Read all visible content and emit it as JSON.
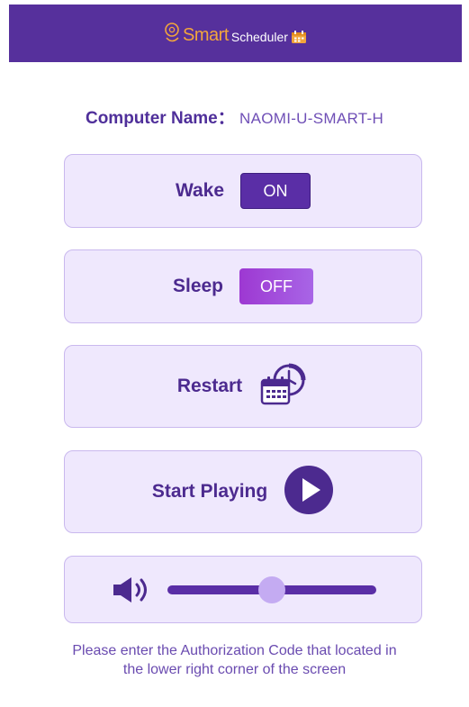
{
  "header": {
    "logo_smart": "Smart",
    "logo_scheduler": "Scheduler"
  },
  "computer": {
    "label": "Computer Name：",
    "value": "NAOMI-U-SMART-H"
  },
  "controls": {
    "wake": {
      "label": "Wake",
      "state": "ON"
    },
    "sleep": {
      "label": "Sleep",
      "state": "OFF"
    },
    "restart": {
      "label": "Restart",
      "icon": "calendar-clock-icon"
    },
    "play": {
      "label": "Start Playing",
      "icon": "play-circle-icon"
    }
  },
  "volume": {
    "icon": "speaker-icon",
    "level": 0.5
  },
  "footer": {
    "note": "Please enter the Authorization Code that located in the lower right corner of the screen"
  },
  "colors": {
    "header_bg": "#56309c",
    "accent": "#5a2ea6",
    "card_bg": "#efe8fd",
    "off_gradient_start": "#9d38d2",
    "logo_orange": "#f2a53c"
  }
}
